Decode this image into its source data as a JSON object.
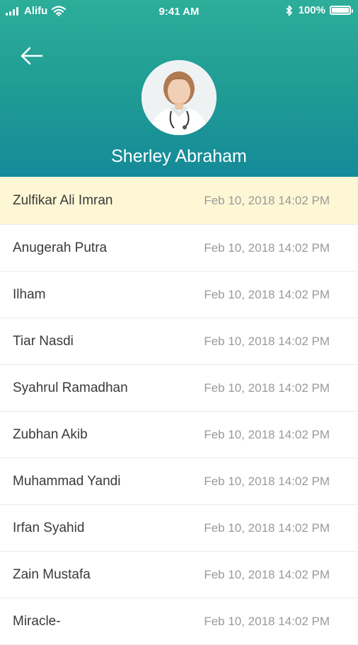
{
  "status_bar": {
    "carrier": "Alifu",
    "time": "9:41 AM",
    "battery": "100%",
    "battery_level": 1.0,
    "icons": [
      "signal-icon",
      "wifi-icon",
      "bluetooth-icon",
      "battery-icon"
    ]
  },
  "header": {
    "back_icon": "arrow-left-icon",
    "profile_name": "Sherley Abraham",
    "gradient_top": "#2cae9a",
    "gradient_bottom": "#158a9a"
  },
  "list": {
    "selected_color": "#fdf7d6",
    "items": [
      {
        "name": "Zulfikar Ali Imran",
        "date": "Feb 10, 2018 14:02 PM",
        "selected": true
      },
      {
        "name": "Anugerah Putra",
        "date": "Feb 10, 2018 14:02 PM"
      },
      {
        "name": "Ilham",
        "date": "Feb 10, 2018 14:02 PM"
      },
      {
        "name": "Tiar Nasdi",
        "date": "Feb 10, 2018 14:02 PM"
      },
      {
        "name": "Syahrul Ramadhan",
        "date": "Feb 10, 2018 14:02 PM"
      },
      {
        "name": "Zubhan Akib",
        "date": "Feb 10, 2018 14:02 PM"
      },
      {
        "name": "Muhammad Yandi",
        "date": "Feb 10, 2018 14:02 PM"
      },
      {
        "name": "Irfan Syahid",
        "date": "Feb 10, 2018 14:02 PM"
      },
      {
        "name": "Zain Mustafa",
        "date": "Feb 10, 2018 14:02 PM"
      },
      {
        "name": "Miracle-",
        "date": "Feb 10, 2018 14:02 PM"
      }
    ]
  }
}
